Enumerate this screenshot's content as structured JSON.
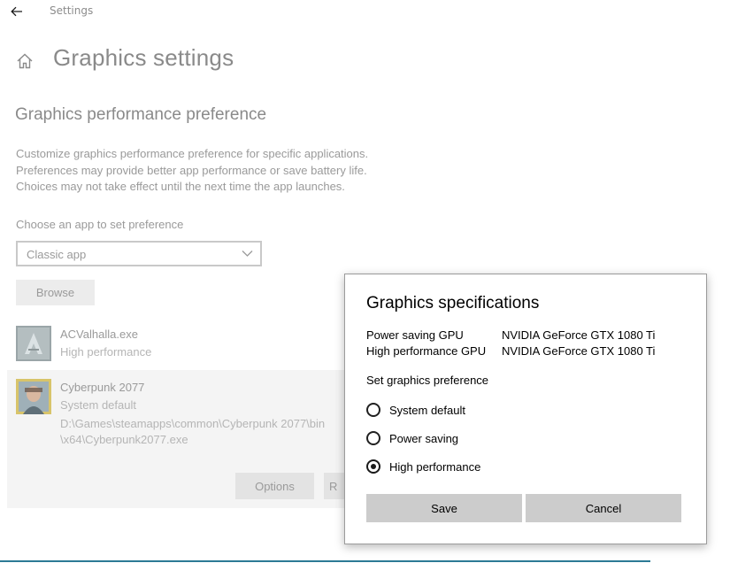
{
  "window": {
    "title": "Settings"
  },
  "page": {
    "title": "Graphics settings",
    "section_title": "Graphics performance preference",
    "description_lines": [
      "Customize graphics performance preference for specific applications.",
      "Preferences may provide better app performance or save battery life.",
      "Choices may not take effect until the next time the app launches."
    ],
    "choose_label": "Choose an app to set preference",
    "app_type_select": {
      "selected": "Classic app"
    },
    "browse_label": "Browse"
  },
  "apps": [
    {
      "name": "ACValhalla.exe",
      "preference": "High performance"
    },
    {
      "name": "Cyberpunk 2077",
      "preference": "System default",
      "path_line1": "D:\\Games\\steamapps\\common\\Cyberpunk 2077\\bin",
      "path_line2": "\\x64\\Cyberpunk2077.exe",
      "options_label": "Options",
      "remove_label": "R"
    }
  ],
  "dialog": {
    "title": "Graphics specifications",
    "specs": [
      {
        "label": "Power saving GPU",
        "value": "NVIDIA GeForce GTX 1080 Ti"
      },
      {
        "label": "High performance GPU",
        "value": "NVIDIA GeForce GTX 1080 Ti"
      }
    ],
    "preference_label": "Set graphics preference",
    "options": [
      {
        "label": "System default",
        "checked": false
      },
      {
        "label": "Power saving",
        "checked": false
      },
      {
        "label": "High performance",
        "checked": true
      }
    ],
    "save_label": "Save",
    "cancel_label": "Cancel"
  },
  "colors": {
    "accent_line": "#2c7a95",
    "button_gray": "#cccccc"
  },
  "icons": {
    "back": "arrow-left-icon",
    "home": "home-icon",
    "dropdown": "chevron-down-icon"
  }
}
